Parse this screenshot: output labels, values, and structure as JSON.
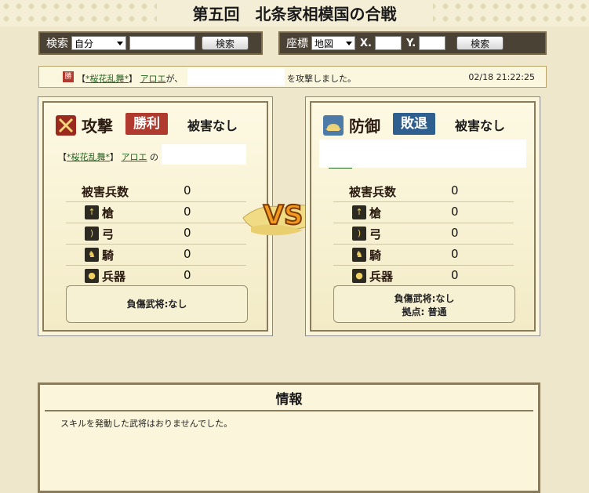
{
  "page": {
    "title": "第五回　北条家相模国の合戦"
  },
  "search": {
    "label": "検索",
    "select_value": "自分",
    "button": "検索"
  },
  "coord": {
    "label": "座標",
    "select_value": "地図",
    "x_label": "X.",
    "y_label": "Y.",
    "button": "検索"
  },
  "log": {
    "badge": "勝",
    "alliance": "【*桜花乱舞*】",
    "alliance_link": "*桜花乱舞*",
    "player": "アロエ",
    "verb": "が、",
    "suffix": "を攻撃しました。",
    "time": "02/18 21:22:25"
  },
  "attacker": {
    "role": "攻撃",
    "result": "勝利",
    "damage": "被害なし",
    "alliance_link": "*桜花乱舞*",
    "player": "アロエ",
    "possessive": "の",
    "casualty": "負傷武将:なし",
    "stats": [
      {
        "label": "被害兵数",
        "value": "0"
      },
      {
        "label": "槍",
        "value": "0"
      },
      {
        "label": "弓",
        "value": "0"
      },
      {
        "label": "騎",
        "value": "0"
      },
      {
        "label": "兵器",
        "value": "0"
      }
    ]
  },
  "defender": {
    "role": "防御",
    "result": "敗退",
    "damage": "被害なし",
    "casualty": "負傷武将:なし",
    "base": "拠点: 普通",
    "stats": [
      {
        "label": "被害兵数",
        "value": "0"
      },
      {
        "label": "槍",
        "value": "0"
      },
      {
        "label": "弓",
        "value": "0"
      },
      {
        "label": "騎",
        "value": "0"
      },
      {
        "label": "兵器",
        "value": "0"
      }
    ]
  },
  "vs": "VS",
  "info": {
    "title": "情報",
    "message": "スキルを発動した武将はおりませんでした。"
  },
  "colors": {
    "win": "#b03a2e",
    "lose": "#2f5f8f",
    "frame": "#8a7c5a",
    "background": "#efe7cb"
  },
  "icons": [
    "sword-icon",
    "helmet-icon",
    "spear-icon",
    "bow-icon",
    "horse-icon",
    "siege-icon"
  ]
}
